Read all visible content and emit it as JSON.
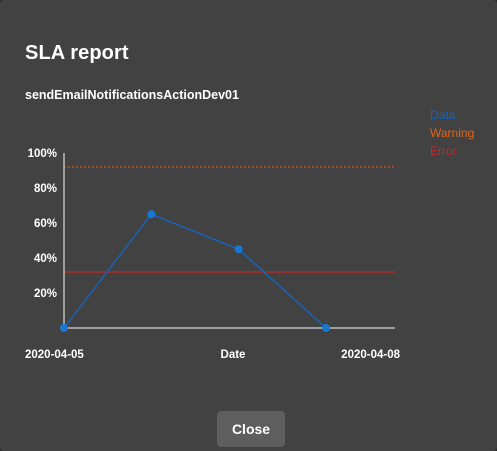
{
  "dialog": {
    "title": "SLA report",
    "subtitle": "sendEmailNotificationsActionDev01",
    "close_label": "Close"
  },
  "colors": {
    "background": "#424242",
    "data": "#1565c0",
    "warning": "#e0651c",
    "error": "#c62828",
    "axis": "#bdbdbd",
    "button": "#5e5e5e"
  },
  "chart_data": {
    "type": "line",
    "xlabel": "Date",
    "ylabel": "",
    "x_tick_labels": [
      "2020-04-05",
      "2020-04-08"
    ],
    "y_ticks": [
      20,
      40,
      60,
      80,
      100
    ],
    "y_tick_labels": [
      "20%",
      "40%",
      "60%",
      "80%",
      "100%"
    ],
    "ylim": [
      0,
      100
    ],
    "xlim": [
      0,
      3
    ],
    "grid": false,
    "legend_position": "top-right",
    "series": [
      {
        "name": "Data",
        "color": "#1565c0",
        "x": [
          0,
          1,
          2,
          3
        ],
        "y": [
          0,
          65,
          45,
          0
        ]
      }
    ],
    "thresholds": [
      {
        "name": "Warning",
        "value": 92,
        "color": "#e0651c",
        "style": "dotted"
      },
      {
        "name": "Error",
        "value": 32,
        "color": "#c62828",
        "style": "solid"
      }
    ]
  }
}
